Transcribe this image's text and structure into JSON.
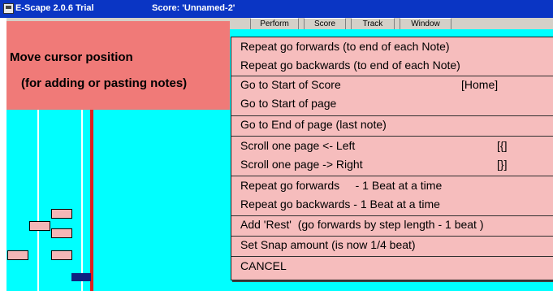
{
  "window": {
    "title": "E-Scape 2.0.6 Trial",
    "score_label": "Score: 'Unnamed-2'"
  },
  "menubar": {
    "items": [
      "Perform",
      "Score",
      "Track",
      "Window"
    ]
  },
  "hint": {
    "line1": "Move cursor position",
    "line2": "(for adding or pasting notes)"
  },
  "context_menu": {
    "items": [
      {
        "label": "Repeat go forwards (to end of each Note)"
      },
      {
        "label": "Repeat go backwards (to end of each Note)"
      },
      {
        "label": "Go to Start of Score",
        "shortcut": "[Home]"
      },
      {
        "label": "Go to Start of page"
      },
      {
        "label": "Go to End of page (last note)"
      },
      {
        "label": "Scroll one page <- Left",
        "shortcut": "[{]"
      },
      {
        "label": "Scroll one page -> Right",
        "shortcut": "[}]"
      },
      {
        "label": "Repeat go forwards     - 1 Beat at a time"
      },
      {
        "label": "Repeat go backwards - 1 Beat at a time"
      },
      {
        "label": "Add 'Rest'  (go forwards by step length - 1 beat )"
      },
      {
        "label": "Set Snap amount (is now 1/4 beat)"
      },
      {
        "label": "CANCEL"
      }
    ]
  },
  "colors": {
    "titlebar": "#0a35c4",
    "workspace": "#00ffff",
    "menu_bg": "#f6bdbd",
    "hint_bg": "#f07a78",
    "cursor_line": "#dd2020",
    "note": "#f3b6b6",
    "selected_note": "#102080"
  }
}
